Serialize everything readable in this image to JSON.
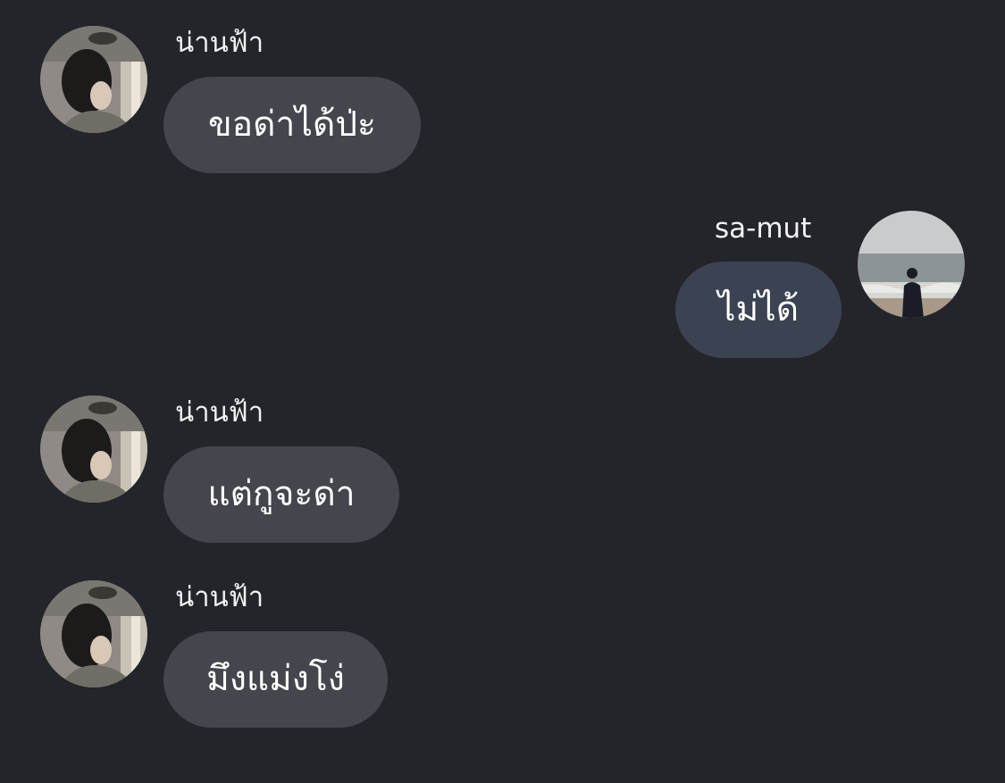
{
  "messages": [
    {
      "side": "incoming",
      "sender": "น่านฟ้า",
      "text": "ขอด่าได้ป่ะ",
      "avatar": "girl-portrait-avatar"
    },
    {
      "side": "outgoing",
      "sender": "sa-mut",
      "text": "ไม่ได้",
      "avatar": "beach-person-avatar"
    },
    {
      "side": "incoming",
      "sender": "น่านฟ้า",
      "text": "แต่กูจะด่า",
      "avatar": "girl-portrait-avatar"
    },
    {
      "side": "incoming",
      "sender": "น่านฟ้า",
      "text": "มึงแม่งโง่",
      "avatar": "girl-portrait-avatar"
    }
  ],
  "colors": {
    "background": "#24252a",
    "incoming_bubble": "#45464d",
    "outgoing_bubble": "#3b4252",
    "text": "#ffffff"
  }
}
